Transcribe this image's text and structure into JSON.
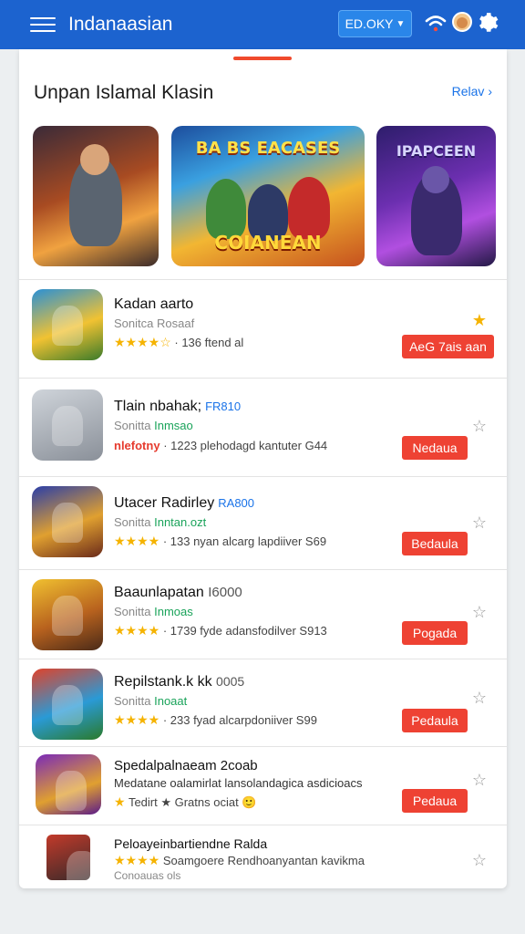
{
  "appbar": {
    "title": "Indanaasian",
    "lang_button": "ED.OKY",
    "icons": [
      "menu-icon",
      "wifi-icon",
      "avatar",
      "gear-icon"
    ],
    "color": "#1c63cf"
  },
  "section": {
    "title": "Unpan Islamal Klasin",
    "link": "Relav ›"
  },
  "banners": [
    {
      "caption_top": "",
      "caption_bottom": ""
    },
    {
      "caption_top": "BA BS EACASES",
      "caption_bottom": "COIANEAN"
    },
    {
      "caption_top": "IPAPCEEN",
      "caption_bottom": ""
    }
  ],
  "apps": [
    {
      "name": "Kadan aarto",
      "tag": "",
      "sub": "Sonitca",
      "sub_accent": "Rosaaf",
      "stars": "★★★★☆",
      "hot": "",
      "meta": "· 136 ftend al",
      "button": "AeG 7ais aan",
      "favorite": true
    },
    {
      "name": "Tlain nbahak;",
      "tag": "FR810",
      "sub": "Sonitta",
      "sub_accent": "Inmsao",
      "stars": "",
      "hot": "nlefotny",
      "meta": "· 1223 plehodagd kantuter G44",
      "button": "Nedaua",
      "favorite": false
    },
    {
      "name": "Utacer Radirley",
      "tag": "RA800",
      "sub": "Sonitta",
      "sub_accent": "Inntan.ozt",
      "stars": "★★★★",
      "hot": "",
      "meta": "· 133 nyan alcarg lapdiiver S69",
      "button": "Bedaula",
      "favorite": false
    },
    {
      "name": "Baaunlapatan",
      "tag": "I6000",
      "sub": "Sonitta",
      "sub_accent": "Inmoas",
      "stars": "★★★★",
      "hot": "",
      "meta": "· 1739 fyde adansfodilver S913",
      "button": "Pogada",
      "favorite": false
    },
    {
      "name": "Repilstank.k kk",
      "tag": "0005",
      "sub": "Sonitta",
      "sub_accent": "Inoaat",
      "stars": "★★★★",
      "hot": "",
      "meta": "· 233 fyad alcarpdoniiver S99",
      "button": "Pedaula",
      "favorite": false
    },
    {
      "name": "Spedalpalnaeam 2coab",
      "tag": "",
      "sub": "Medatane oalamirlat lansolandagica asdicioacs",
      "sub_accent": "",
      "stars": "★",
      "hot": "",
      "meta": "Tedirt ★ Gratns ociat 🙂",
      "button": "Pedaua",
      "favorite": false
    },
    {
      "name": "Peloayeinbartiendne Ralda",
      "tag": "",
      "sub": "",
      "sub_accent": "",
      "stars": "★★★★",
      "hot": "",
      "meta": "Soamgoere Rendhoanyantan kavikma",
      "sub2": "Conoauas ols",
      "button": "",
      "favorite": false
    }
  ]
}
